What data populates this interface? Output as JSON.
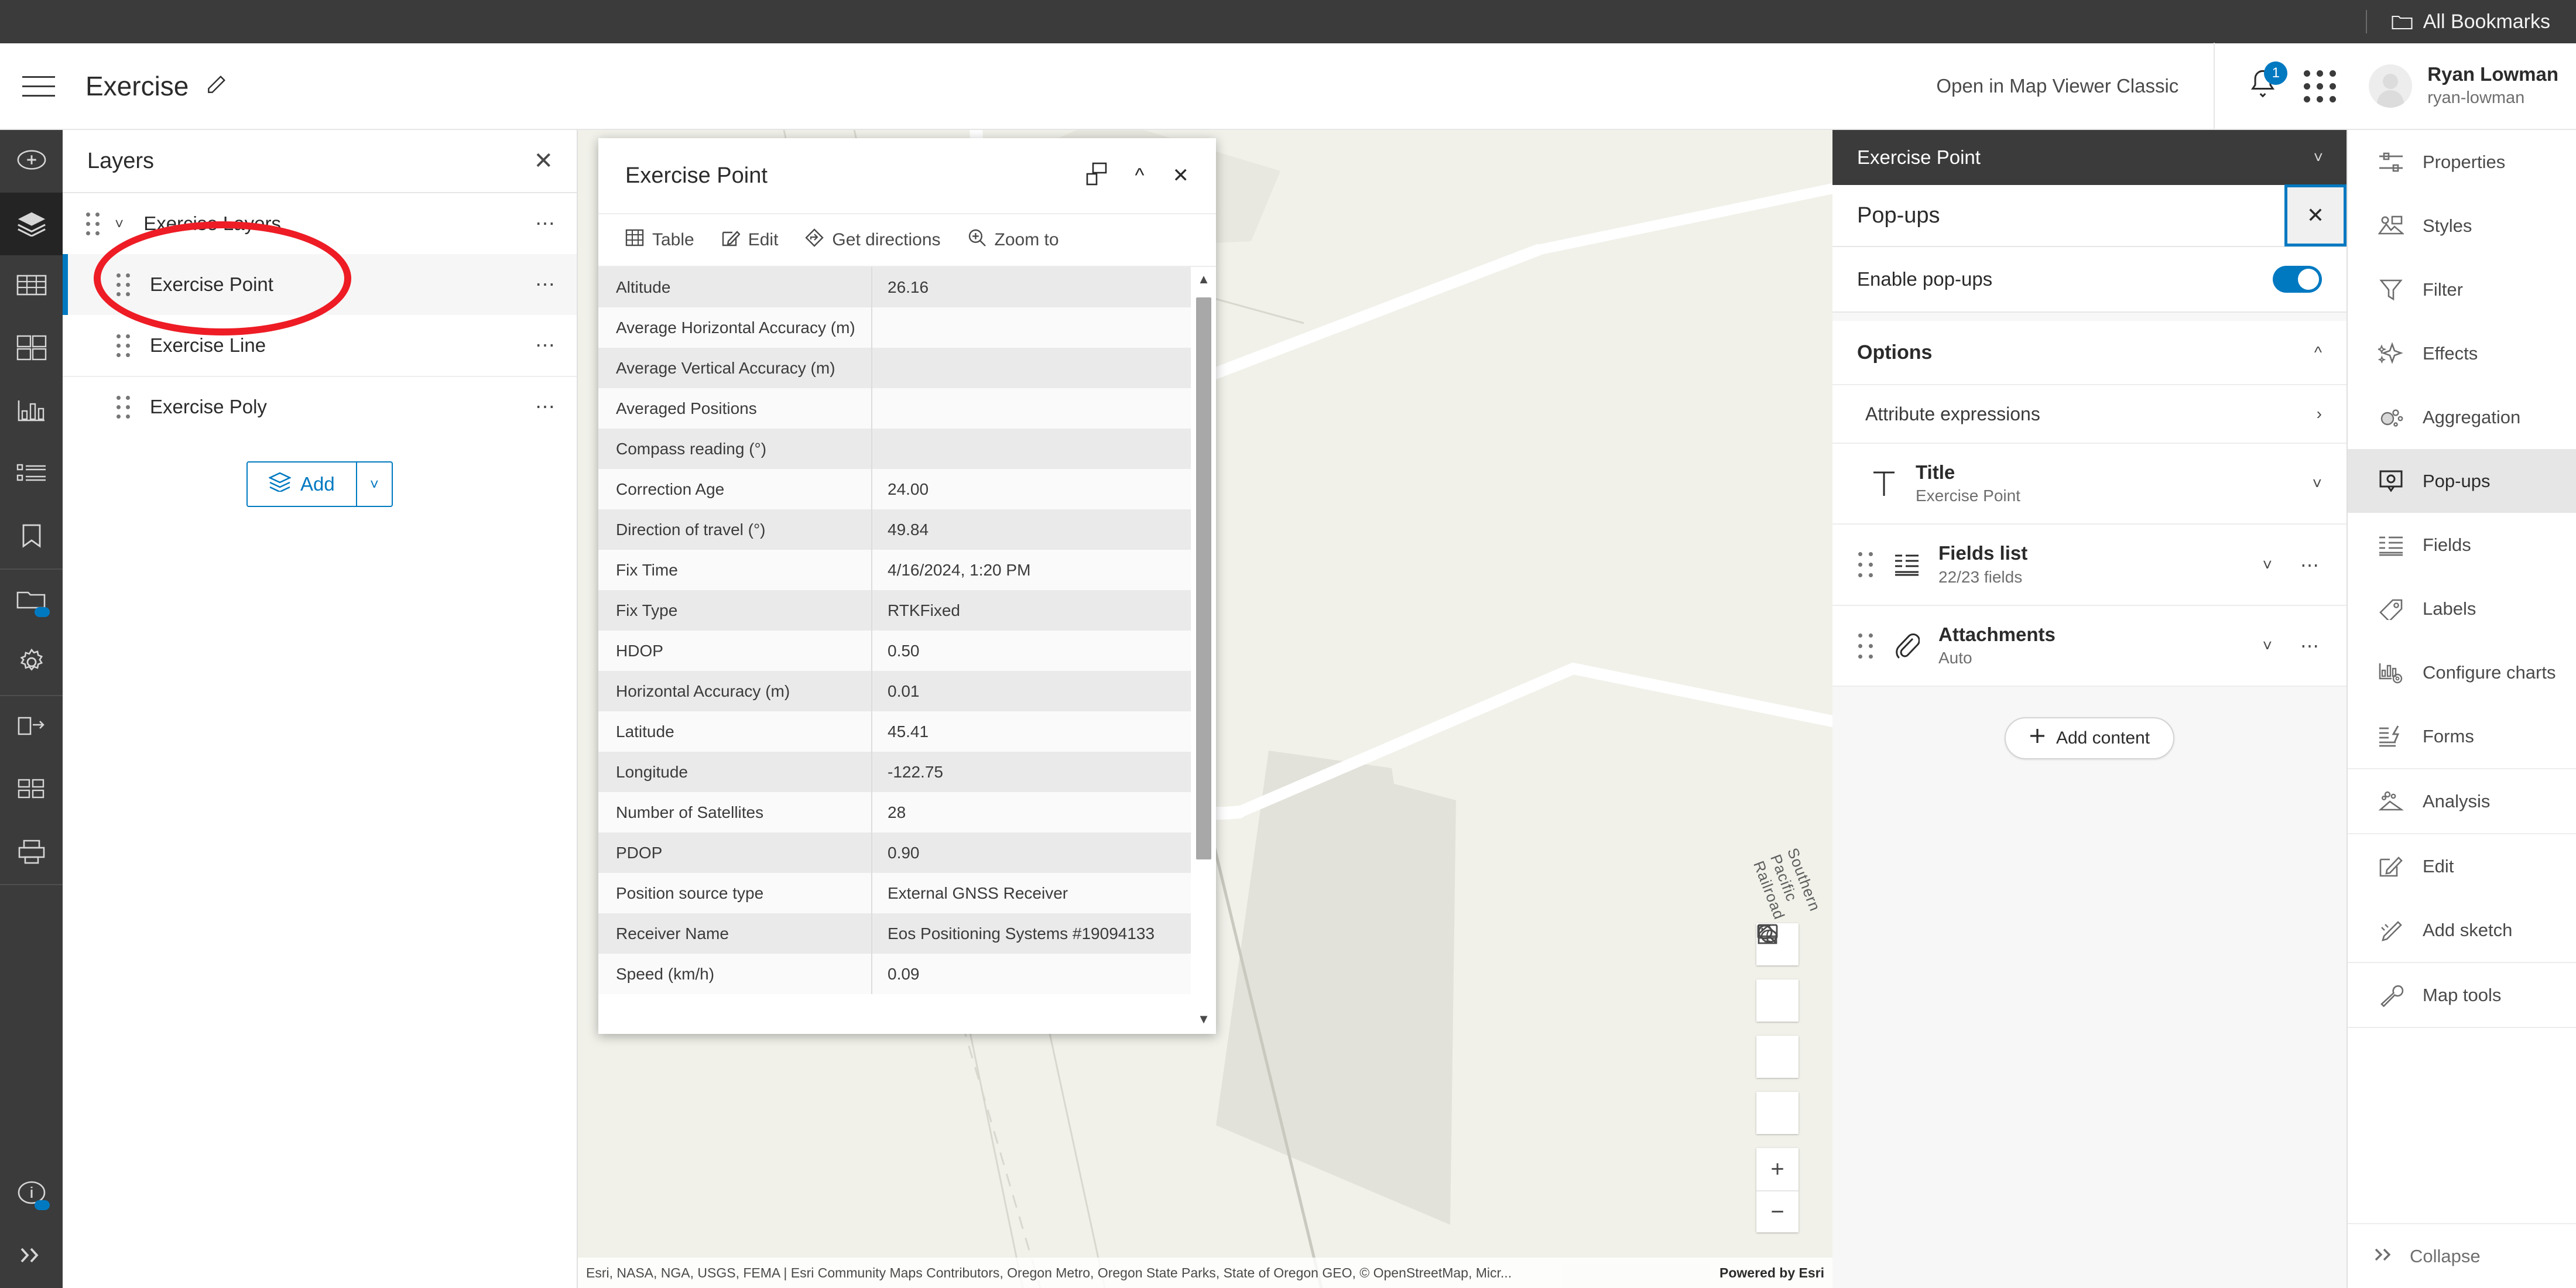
{
  "topbar": {
    "bookmarks_label": "All Bookmarks",
    "bookmarks_icon": "folder-icon"
  },
  "header": {
    "map_title": "Exercise",
    "edit_icon": "pencil-icon",
    "menu_icon": "hamburger-icon",
    "open_classic_label": "Open in Map Viewer Classic",
    "notification_count": "1",
    "notification_icon": "bell-icon",
    "apps_icon": "app-grid-icon",
    "user_name": "Ryan Lowman",
    "user_handle": "ryan-lowman"
  },
  "rail": {
    "items": [
      {
        "name": "add-layer",
        "icon": "plus-circle-icon",
        "active": false
      },
      {
        "name": "layers",
        "icon": "layers-icon",
        "active": true
      },
      {
        "name": "tables",
        "icon": "table-icon",
        "active": false
      },
      {
        "name": "basemap",
        "icon": "basemap-icon",
        "active": false
      },
      {
        "name": "charts",
        "icon": "chart-icon",
        "active": false
      },
      {
        "name": "legend",
        "icon": "legend-icon",
        "active": false
      },
      {
        "name": "bookmarks",
        "icon": "bookmark-icon",
        "active": false
      },
      {
        "name": "basemap-gallery",
        "icon": "folder-dot-icon",
        "active": false
      },
      {
        "name": "map-properties",
        "icon": "gear-icon",
        "active": false
      },
      {
        "name": "share",
        "icon": "share-icon",
        "active": false
      },
      {
        "name": "apps",
        "icon": "grid-icon",
        "active": false
      },
      {
        "name": "print",
        "icon": "printer-icon",
        "active": false
      }
    ],
    "info_icon": "info-circle-icon",
    "expand_icon": "chevron-double-right-icon"
  },
  "layers_panel": {
    "title": "Layers",
    "close_icon": "close-icon",
    "items": [
      {
        "label": "Exercise Layers",
        "type": "group",
        "expanded": true,
        "selected": false
      },
      {
        "label": "Exercise Point",
        "type": "layer",
        "selected": true
      },
      {
        "label": "Exercise Line",
        "type": "layer",
        "selected": false
      },
      {
        "label": "Exercise Poly",
        "type": "layer",
        "selected": false
      }
    ],
    "add_label": "Add",
    "add_icon": "layers-add-icon",
    "add_caret_icon": "chevron-down-icon"
  },
  "popup": {
    "title": "Exercise Point",
    "dock_icon": "dock-icon",
    "collapse_icon": "chevron-up-icon",
    "close_icon": "close-icon",
    "toolbar": [
      {
        "label": "Table",
        "icon": "table-icon"
      },
      {
        "label": "Edit",
        "icon": "pencil-square-icon"
      },
      {
        "label": "Get directions",
        "icon": "directions-icon"
      },
      {
        "label": "Zoom to",
        "icon": "zoom-in-icon"
      }
    ],
    "attributes": [
      {
        "key": "Altitude",
        "value": "26.16"
      },
      {
        "key": "Average Horizontal Accuracy (m)",
        "value": ""
      },
      {
        "key": "Average Vertical Accuracy (m)",
        "value": ""
      },
      {
        "key": "Averaged Positions",
        "value": ""
      },
      {
        "key": "Compass reading (°)",
        "value": ""
      },
      {
        "key": "Correction Age",
        "value": "24.00"
      },
      {
        "key": "Direction of travel (°)",
        "value": "49.84"
      },
      {
        "key": "Fix Time",
        "value": "4/16/2024, 1:20 PM"
      },
      {
        "key": "Fix Type",
        "value": "RTKFixed"
      },
      {
        "key": "HDOP",
        "value": "0.50"
      },
      {
        "key": "Horizontal Accuracy (m)",
        "value": "0.01"
      },
      {
        "key": "Latitude",
        "value": "45.41"
      },
      {
        "key": "Longitude",
        "value": "-122.75"
      },
      {
        "key": "Number of Satellites",
        "value": "28"
      },
      {
        "key": "PDOP",
        "value": "0.90"
      },
      {
        "key": "Position source type",
        "value": "External GNSS Receiver"
      },
      {
        "key": "Receiver Name",
        "value": "Eos Positioning Systems #19094133"
      },
      {
        "key": "Speed (km/h)",
        "value": "0.09"
      }
    ]
  },
  "map": {
    "railroad_label": "Southern Pacific Railroad",
    "attribution": "Esri, NASA, NGA, USGS, FEMA | Esri Community Maps Contributors, Oregon Metro, Oregon State Parks, State of Oregon GEO, © OpenStreetMap, Micr...",
    "powered_by": "Powered by Esri",
    "controls": [
      {
        "name": "search",
        "icon": "search-icon"
      },
      {
        "name": "basemap-globe",
        "icon": "globe-icon"
      },
      {
        "name": "full-screen",
        "icon": "monitor-icon"
      },
      {
        "name": "home",
        "icon": "home-icon"
      }
    ],
    "zoom_in": "+",
    "zoom_out": "−"
  },
  "popups_panel": {
    "layer_name": "Exercise Point",
    "layer_chev_icon": "chevron-down-icon",
    "title": "Pop-ups",
    "close_icon": "close-icon",
    "enable_label": "Enable pop-ups",
    "enable_on": true,
    "options_label": "Options",
    "options_chev_icon": "chevron-up-icon",
    "attribute_expressions_label": "Attribute expressions",
    "attribute_expressions_chev_icon": "chevron-right-icon",
    "cards": [
      {
        "title": "Title",
        "subtitle": "Exercise Point",
        "icon": "text-title-icon",
        "draggable": false,
        "has_menu": false
      },
      {
        "title": "Fields list",
        "subtitle": "22/23 fields",
        "icon": "fields-list-icon",
        "draggable": true,
        "has_menu": true
      },
      {
        "title": "Attachments",
        "subtitle": "Auto",
        "icon": "paperclip-icon",
        "draggable": true,
        "has_menu": true
      }
    ],
    "add_content_label": "Add content",
    "add_content_icon": "plus-icon"
  },
  "right_menu": {
    "items": [
      {
        "label": "Properties",
        "icon": "sliders-icon",
        "active": false,
        "sep_after": false
      },
      {
        "label": "Styles",
        "icon": "styles-icon",
        "active": false,
        "sep_after": false
      },
      {
        "label": "Filter",
        "icon": "funnel-icon",
        "active": false,
        "sep_after": false
      },
      {
        "label": "Effects",
        "icon": "sparkle-icon",
        "active": false,
        "sep_after": false
      },
      {
        "label": "Aggregation",
        "icon": "aggregation-icon",
        "active": false,
        "sep_after": false
      },
      {
        "label": "Pop-ups",
        "icon": "popup-gear-icon",
        "active": true,
        "sep_after": false
      },
      {
        "label": "Fields",
        "icon": "fields-icon",
        "active": false,
        "sep_after": false
      },
      {
        "label": "Labels",
        "icon": "label-tag-icon",
        "active": false,
        "sep_after": false
      },
      {
        "label": "Configure charts",
        "icon": "chart-gear-icon",
        "active": false,
        "sep_after": false
      },
      {
        "label": "Forms",
        "icon": "form-icon",
        "active": false,
        "sep_after": true
      },
      {
        "label": "Analysis",
        "icon": "analysis-icon",
        "active": false,
        "sep_after": true
      },
      {
        "label": "Edit",
        "icon": "pencil-square-icon",
        "active": false,
        "sep_after": false
      },
      {
        "label": "Add sketch",
        "icon": "sketch-pencil-icon",
        "active": false,
        "sep_after": true
      },
      {
        "label": "Map tools",
        "icon": "wrench-icon",
        "active": false,
        "sep_after": true
      }
    ],
    "collapse_label": "Collapse",
    "collapse_icon": "chevron-double-right-icon"
  }
}
